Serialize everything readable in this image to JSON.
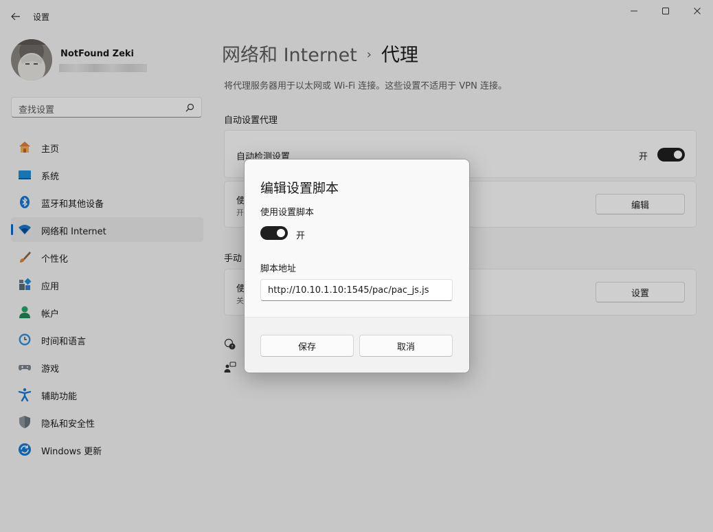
{
  "window": {
    "title": "设置",
    "back_icon": "arrow-left-icon",
    "controls": [
      "minimize-icon",
      "maximize-icon",
      "close-icon"
    ]
  },
  "profile": {
    "name": "NotFound Zeki"
  },
  "search": {
    "placeholder": "查找设置"
  },
  "sidebar": {
    "items": [
      {
        "label": "主页",
        "icon": "home-icon"
      },
      {
        "label": "系统",
        "icon": "system-icon"
      },
      {
        "label": "蓝牙和其他设备",
        "icon": "bluetooth-icon"
      },
      {
        "label": "网络和 Internet",
        "icon": "wifi-icon",
        "selected": true
      },
      {
        "label": "个性化",
        "icon": "brush-icon"
      },
      {
        "label": "应用",
        "icon": "apps-icon"
      },
      {
        "label": "帐户",
        "icon": "person-icon"
      },
      {
        "label": "时间和语言",
        "icon": "clock-globe-icon"
      },
      {
        "label": "游戏",
        "icon": "gamepad-icon"
      },
      {
        "label": "辅助功能",
        "icon": "accessibility-icon"
      },
      {
        "label": "隐私和安全性",
        "icon": "shield-icon"
      },
      {
        "label": "Windows 更新",
        "icon": "update-icon"
      }
    ]
  },
  "main": {
    "breadcrumb_parent": "网络和 Internet",
    "breadcrumb_separator": "›",
    "breadcrumb_current": "代理",
    "description": "将代理服务器用于以太网或 Wi-Fi 连接。这些设置不适用于 VPN 连接。",
    "auto_section_title": "自动设置代理",
    "auto_detect": {
      "title": "自动检测设置",
      "toggle_state": "开",
      "toggle_on": true
    },
    "setup_script": {
      "title_visible": "使",
      "sub_visible": "开",
      "button": "编辑"
    },
    "manual_section_title_visible": "手动",
    "manual_proxy": {
      "title_visible": "使",
      "sub_visible": "关",
      "button": "设置"
    },
    "help_icons": [
      "help-chat-icon",
      "feedback-icon"
    ]
  },
  "dialog": {
    "title": "编辑设置脚本",
    "use_script_label": "使用设置脚本",
    "toggle_state": "开",
    "toggle_on": true,
    "address_label": "脚本地址",
    "address_value": "http://10.10.1.10:1545/pac/pac_js.js",
    "save_button": "保存",
    "cancel_button": "取消"
  },
  "colors": {
    "accent": "#0067c0",
    "toggle_on": "#1f1f1f",
    "window_bg": "#f3f3f3"
  }
}
